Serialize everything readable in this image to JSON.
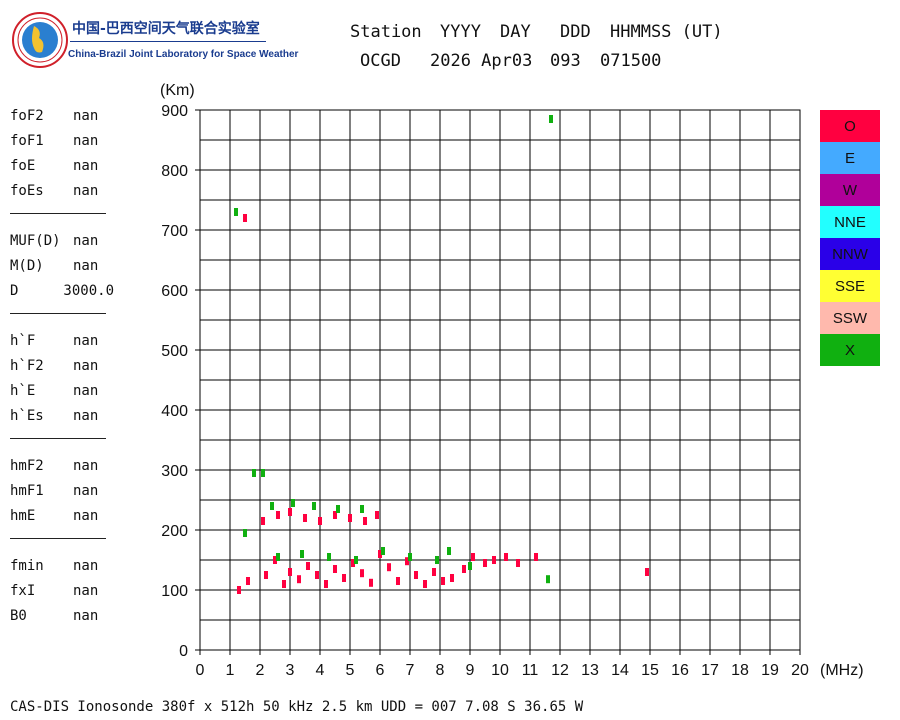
{
  "logo": {
    "cn_name": "中国-巴西空间天气联合实验室",
    "en_name": "China-Brazil Joint Laboratory for Space Weather",
    "icon": "globe-logo-icon",
    "colors": {
      "ring": "#d0202a",
      "globe": "#2a7fd0",
      "land": "#f2c230",
      "text": "#1a3c8f"
    }
  },
  "header": {
    "columns": [
      "Station",
      "YYYY",
      "DAY",
      "DDD",
      "HHMMSS (UT)"
    ],
    "values": [
      "OCGD",
      "2026 Apr03",
      "093",
      "071500"
    ]
  },
  "parameters": [
    {
      "group": [
        {
          "name": "foF2",
          "value": "nan"
        },
        {
          "name": "foF1",
          "value": "nan"
        },
        {
          "name": "foE",
          "value": "nan"
        },
        {
          "name": "foEs",
          "value": "nan"
        }
      ]
    },
    {
      "group": [
        {
          "name": "MUF(D)",
          "value": "nan"
        },
        {
          "name": "M(D)",
          "value": "nan"
        },
        {
          "name": "D",
          "value": "3000.0"
        }
      ]
    },
    {
      "group": [
        {
          "name": "h`F",
          "value": "nan"
        },
        {
          "name": "h`F2",
          "value": "nan"
        },
        {
          "name": "h`E",
          "value": "nan"
        },
        {
          "name": "h`Es",
          "value": "nan"
        }
      ]
    },
    {
      "group": [
        {
          "name": "hmF2",
          "value": "nan"
        },
        {
          "name": "hmF1",
          "value": "nan"
        },
        {
          "name": "hmE",
          "value": "nan"
        }
      ]
    },
    {
      "group": [
        {
          "name": "fmin",
          "value": "nan"
        },
        {
          "name": "fxI",
          "value": "nan"
        },
        {
          "name": "B0",
          "value": "nan"
        }
      ]
    }
  ],
  "legend": [
    {
      "label": "O",
      "color": "#ff0040"
    },
    {
      "label": "E",
      "color": "#44aaff"
    },
    {
      "label": "W",
      "color": "#b0009a"
    },
    {
      "label": "NNE",
      "color": "#22ffff"
    },
    {
      "label": "NNW",
      "color": "#2a00e8"
    },
    {
      "label": "SSE",
      "color": "#ffff33"
    },
    {
      "label": "SSW",
      "color": "#ffb9ad"
    },
    {
      "label": "X",
      "color": "#10b010"
    }
  ],
  "footer": "CAS-DIS Ionosonde 380f x 512h 50 kHz 2.5 km UDD = 007 7.08 S 36.65 W",
  "chart_data": {
    "type": "scatter",
    "title": "",
    "xlabel": "(MHz)",
    "ylabel": "(Km)",
    "xlim": [
      0,
      20
    ],
    "ylim": [
      0,
      900
    ],
    "xticks": [
      0,
      1,
      2,
      3,
      4,
      5,
      6,
      7,
      8,
      9,
      10,
      11,
      12,
      13,
      14,
      15,
      16,
      17,
      18,
      19,
      20
    ],
    "yticks": [
      0,
      100,
      200,
      300,
      400,
      500,
      600,
      700,
      800,
      900
    ],
    "grid": true,
    "series": [
      {
        "name": "O",
        "color": "#ff0040",
        "points": [
          [
            1.5,
            720
          ],
          [
            1.3,
            100
          ],
          [
            1.6,
            115
          ],
          [
            2.2,
            125
          ],
          [
            2.5,
            150
          ],
          [
            2.8,
            110
          ],
          [
            3.0,
            130
          ],
          [
            3.3,
            118
          ],
          [
            3.6,
            140
          ],
          [
            3.9,
            125
          ],
          [
            4.2,
            110
          ],
          [
            4.5,
            135
          ],
          [
            4.8,
            120
          ],
          [
            5.1,
            145
          ],
          [
            5.4,
            128
          ],
          [
            5.7,
            112
          ],
          [
            6.0,
            160
          ],
          [
            6.3,
            138
          ],
          [
            6.6,
            115
          ],
          [
            6.9,
            148
          ],
          [
            7.2,
            125
          ],
          [
            7.5,
            110
          ],
          [
            7.8,
            130
          ],
          [
            8.1,
            115
          ],
          [
            8.4,
            120
          ],
          [
            8.8,
            135
          ],
          [
            9.1,
            155
          ],
          [
            9.5,
            145
          ],
          [
            9.8,
            150
          ],
          [
            10.2,
            155
          ],
          [
            10.6,
            145
          ],
          [
            11.2,
            155
          ],
          [
            14.9,
            130
          ],
          [
            2.1,
            215
          ],
          [
            2.6,
            225
          ],
          [
            3.0,
            230
          ],
          [
            3.5,
            220
          ],
          [
            4.0,
            215
          ],
          [
            4.5,
            225
          ],
          [
            5.0,
            220
          ],
          [
            5.5,
            215
          ],
          [
            5.9,
            225
          ]
        ]
      },
      {
        "name": "X",
        "color": "#10b010",
        "points": [
          [
            1.2,
            730
          ],
          [
            11.7,
            885
          ],
          [
            1.8,
            295
          ],
          [
            2.1,
            295
          ],
          [
            1.5,
            195
          ],
          [
            2.4,
            240
          ],
          [
            3.1,
            245
          ],
          [
            3.8,
            240
          ],
          [
            4.6,
            235
          ],
          [
            5.4,
            235
          ],
          [
            2.6,
            155
          ],
          [
            3.4,
            160
          ],
          [
            4.3,
            155
          ],
          [
            5.2,
            150
          ],
          [
            6.1,
            165
          ],
          [
            7.0,
            155
          ],
          [
            7.9,
            150
          ],
          [
            8.3,
            165
          ],
          [
            9.0,
            140
          ],
          [
            11.6,
            118
          ]
        ]
      }
    ]
  }
}
